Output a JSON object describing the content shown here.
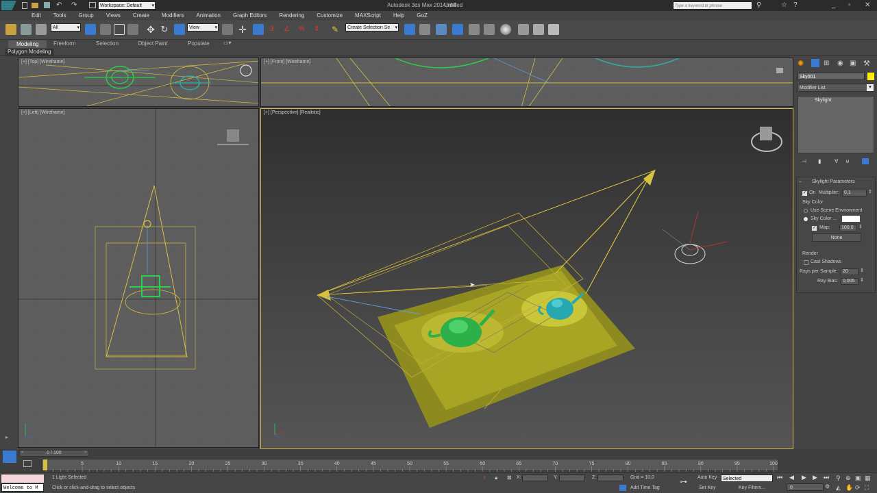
{
  "titlebar": {
    "workspace": "Workspace: Default",
    "app_title": "Autodesk 3ds Max  2014 x64",
    "doc_title": "Untitled",
    "search_placeholder": "Type a keyword or phrase"
  },
  "menus": [
    "Edit",
    "Tools",
    "Group",
    "Views",
    "Create",
    "Modifiers",
    "Animation",
    "Graph Editors",
    "Rendering",
    "Customize",
    "MAXScript",
    "Help",
    "GoZ"
  ],
  "toolbar": {
    "selection_filter": "All",
    "ref_coord": "View",
    "named_selection": "Create Selection Se"
  },
  "ribbon": {
    "tabs": [
      "Modeling",
      "Freeform",
      "Selection",
      "Object Paint",
      "Populate"
    ],
    "active_tab": "Modeling",
    "panel_label": "Polygon Modeling"
  },
  "viewports": {
    "top": "[+] [Top] [Wireframe]",
    "front": "[+] [Front] [Wireframe]",
    "left": "[+] [Left] [Wireframe]",
    "perspective": "[+] [Perspective] [Realistic]"
  },
  "command_panel": {
    "object_name": "Sky001",
    "modifier_list": "Modifier List",
    "stack_item": "Skylight",
    "rollout_title": "Skylight Parameters",
    "on_label": "On",
    "multiplier_label": "Multiplier:",
    "multiplier_value": "0,1",
    "sky_color_group": "Sky Color",
    "use_scene_env": "Use Scene Environment",
    "sky_color_label": "Sky Color ...",
    "map_label": "Map:",
    "map_value": "100,0",
    "map_button": "None",
    "render_group": "Render",
    "cast_shadows": "Cast Shadows",
    "rays_label": "Rays per Sample:",
    "rays_value": "20",
    "ray_bias_label": "Ray Bias:",
    "ray_bias_value": "0,005",
    "colors": {
      "object_color": "#ffee00",
      "sky_color": "#ffffff"
    }
  },
  "timeline": {
    "frame_display": "0 / 100",
    "ticks": [
      "0",
      "5",
      "10",
      "15",
      "20",
      "25",
      "30",
      "35",
      "40",
      "45",
      "50",
      "55",
      "60",
      "65",
      "70",
      "75",
      "80",
      "85",
      "90",
      "95",
      "100"
    ]
  },
  "status": {
    "selection": "1 Light Selected",
    "prompt": "Click or click-and-drag to select objects",
    "listener": "Welcome to M",
    "x_label": "X:",
    "y_label": "Y:",
    "z_label": "Z:",
    "grid": "Grid = 10,0",
    "add_time_tag": "Add Time Tag",
    "auto_key": "Auto Key",
    "auto_key_value": "Selected",
    "set_key": "Set Key",
    "key_filters": "Key Filters...",
    "current_frame": "0"
  }
}
